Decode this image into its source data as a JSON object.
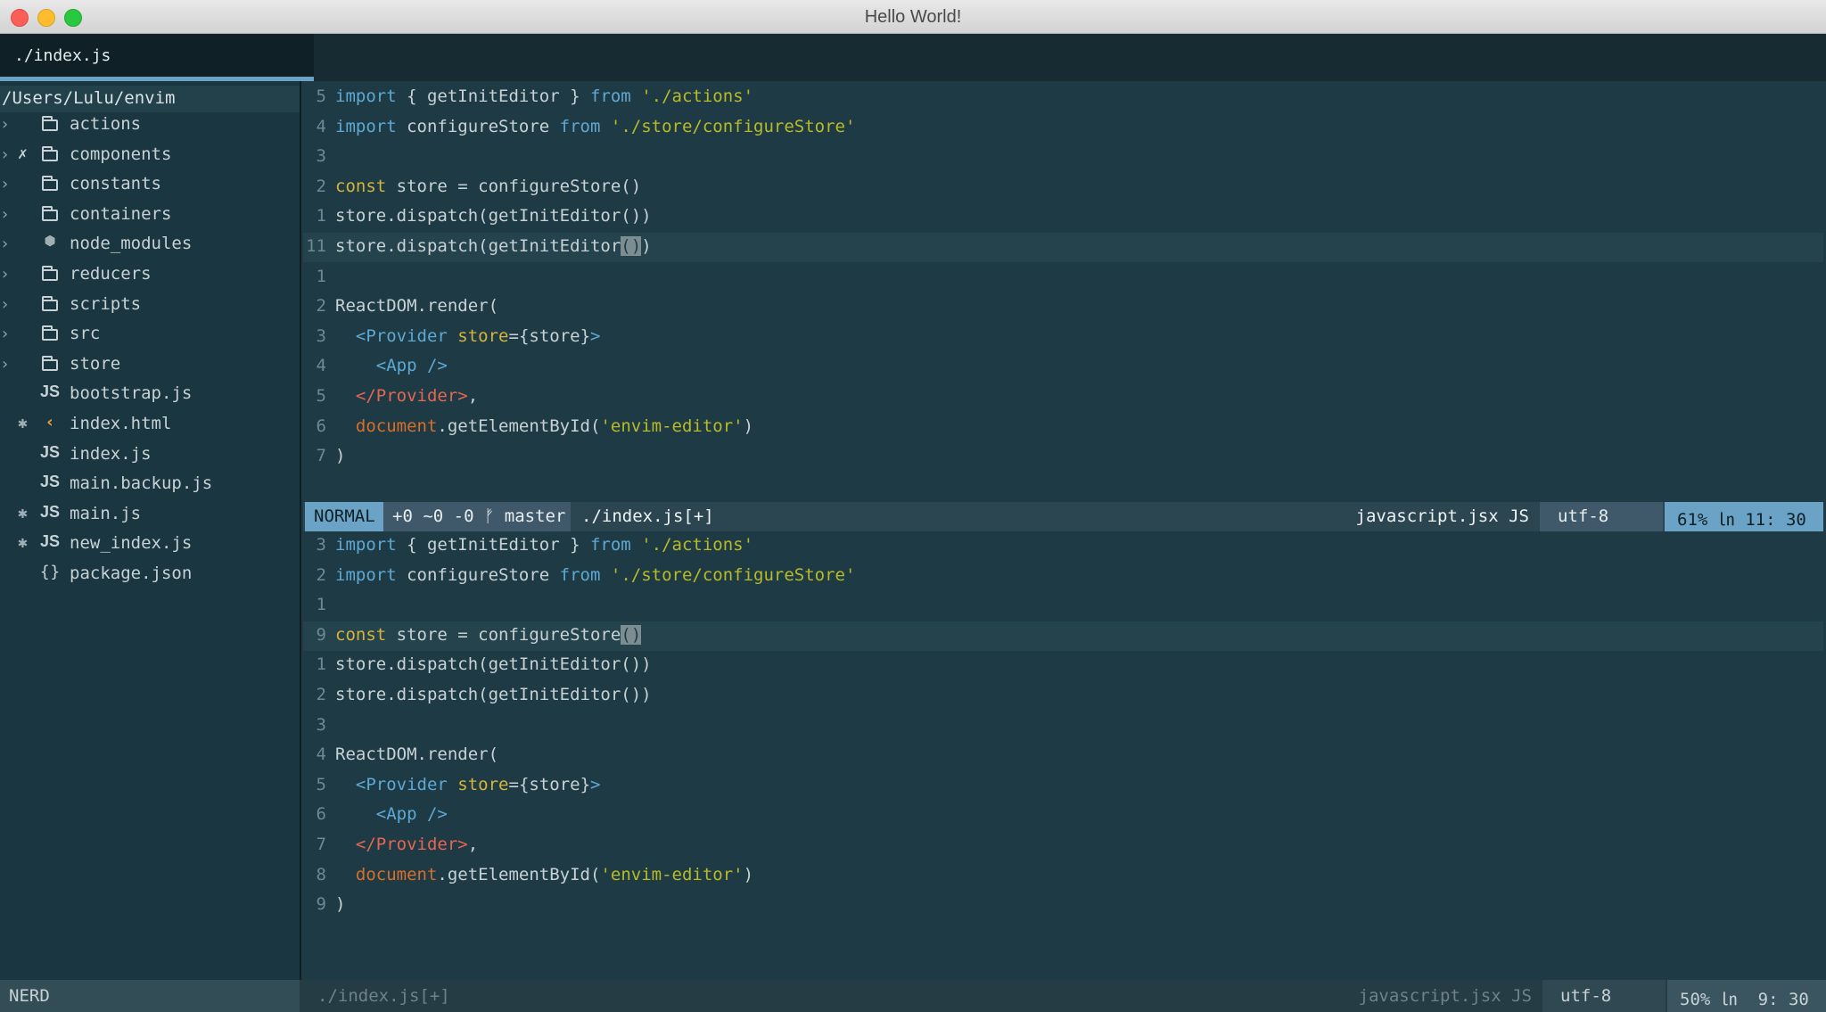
{
  "window": {
    "title": "Hello World!"
  },
  "tabline": {
    "active_tab": "./index.js"
  },
  "sidebar": {
    "root": "/Users/Lulu/envim",
    "items": [
      {
        "arrow": "›",
        "git": "",
        "icon": "folder-icon",
        "name": "actions"
      },
      {
        "arrow": "›",
        "git": "✗",
        "icon": "folder-icon",
        "name": "components"
      },
      {
        "arrow": "›",
        "git": "",
        "icon": "folder-icon",
        "name": "constants"
      },
      {
        "arrow": "›",
        "git": "",
        "icon": "folder-icon",
        "name": "containers"
      },
      {
        "arrow": "›",
        "git": "",
        "icon": "npm-icon",
        "name": "node_modules"
      },
      {
        "arrow": "›",
        "git": "",
        "icon": "folder-icon",
        "name": "reducers"
      },
      {
        "arrow": "›",
        "git": "",
        "icon": "folder-icon",
        "name": "scripts"
      },
      {
        "arrow": "›",
        "git": "",
        "icon": "folder-icon",
        "name": "src"
      },
      {
        "arrow": "›",
        "git": "",
        "icon": "folder-icon",
        "name": "store"
      },
      {
        "arrow": "",
        "git": "",
        "icon": "js-icon",
        "name": "bootstrap.js"
      },
      {
        "arrow": "",
        "git": "✱",
        "icon": "html-icon",
        "name": "index.html"
      },
      {
        "arrow": "",
        "git": "",
        "icon": "js-icon",
        "name": "index.js"
      },
      {
        "arrow": "",
        "git": "",
        "icon": "js-icon",
        "name": "main.backup.js"
      },
      {
        "arrow": "",
        "git": "✱",
        "icon": "js-icon",
        "name": "main.js"
      },
      {
        "arrow": "",
        "git": "✱",
        "icon": "js-icon",
        "name": "new_index.js"
      },
      {
        "arrow": "",
        "git": "",
        "icon": "json-icon",
        "name": "package.json"
      }
    ]
  },
  "top_pane": {
    "lines": [
      {
        "n": "5",
        "tokens": [
          [
            "kw",
            "import"
          ],
          [
            "",
            "{ getInitEditor } "
          ],
          [
            "kw",
            "from"
          ],
          [
            "",
            " "
          ],
          [
            "str",
            "'./actions'"
          ]
        ]
      },
      {
        "n": "4",
        "tokens": [
          [
            "kw",
            "import"
          ],
          [
            "",
            " configureStore "
          ],
          [
            "kw",
            "from"
          ],
          [
            "",
            " "
          ],
          [
            "str",
            "'./store/configureStore'"
          ]
        ]
      },
      {
        "n": "3",
        "tokens": []
      },
      {
        "n": "2",
        "tokens": [
          [
            "cst",
            "const"
          ],
          [
            "",
            " store = configureStore()"
          ]
        ]
      },
      {
        "n": "1",
        "tokens": [
          [
            "",
            "store.dispatch(getInitEditor())"
          ]
        ]
      },
      {
        "n": "11",
        "cursorline": true,
        "tokens": [
          [
            "",
            "store.dispatch(getInitEditor"
          ],
          [
            "cur",
            "()"
          ],
          [
            "",
            ")"
          ]
        ]
      },
      {
        "n": "1",
        "tokens": []
      },
      {
        "n": "2",
        "tokens": [
          [
            "",
            "ReactDOM.render("
          ]
        ]
      },
      {
        "n": "3",
        "tokens": [
          [
            "",
            "  "
          ],
          [
            "tag",
            "<Provider"
          ],
          [
            "",
            " "
          ],
          [
            "attr",
            "store"
          ],
          [
            "",
            "={store}"
          ],
          [
            "tag",
            ">"
          ]
        ]
      },
      {
        "n": "4",
        "tokens": [
          [
            "",
            "    "
          ],
          [
            "tag",
            "<App />"
          ]
        ]
      },
      {
        "n": "5",
        "tokens": [
          [
            "",
            "  "
          ],
          [
            "ctag",
            "</Provider>"
          ],
          [
            "",
            ","
          ]
        ]
      },
      {
        "n": "6",
        "tokens": [
          [
            "",
            "  "
          ],
          [
            "doc",
            "document"
          ],
          [
            "",
            ".getElementById("
          ],
          [
            "str",
            "'envim-editor'"
          ],
          [
            "",
            ")"
          ]
        ]
      },
      {
        "n": "7",
        "tokens": [
          [
            "",
            ")"
          ]
        ]
      }
    ]
  },
  "statusline": {
    "mode": "NORMAL",
    "git": "+0 ~0 -0 ᚠ master",
    "file": "./index.js[+]",
    "filetype": "javascript.jsx JS",
    "encoding": "utf-8 ",
    "position": "61% ㏑ 11: 30"
  },
  "bottom_pane": {
    "lines": [
      {
        "n": "3",
        "tokens": [
          [
            "kw",
            "import"
          ],
          [
            "",
            "{ getInitEditor } "
          ],
          [
            "kw",
            "from"
          ],
          [
            "",
            " "
          ],
          [
            "str",
            "'./actions'"
          ]
        ]
      },
      {
        "n": "2",
        "tokens": [
          [
            "kw",
            "import"
          ],
          [
            "",
            " configureStore "
          ],
          [
            "kw",
            "from"
          ],
          [
            "",
            " "
          ],
          [
            "str",
            "'./store/configureStore'"
          ]
        ]
      },
      {
        "n": "1",
        "tokens": []
      },
      {
        "n": "9",
        "cursorline": true,
        "tokens": [
          [
            "cst",
            "const"
          ],
          [
            "",
            " store = configureStore"
          ],
          [
            "cur",
            "()"
          ]
        ]
      },
      {
        "n": "1",
        "tokens": [
          [
            "",
            "store.dispatch(getInitEditor())"
          ]
        ]
      },
      {
        "n": "2",
        "tokens": [
          [
            "",
            "store.dispatch(getInitEditor())"
          ]
        ]
      },
      {
        "n": "3",
        "tokens": []
      },
      {
        "n": "4",
        "tokens": [
          [
            "",
            "ReactDOM.render("
          ]
        ]
      },
      {
        "n": "5",
        "tokens": [
          [
            "",
            "  "
          ],
          [
            "tag",
            "<Provider"
          ],
          [
            "",
            " "
          ],
          [
            "attr",
            "store"
          ],
          [
            "",
            "={store}"
          ],
          [
            "tag",
            ">"
          ]
        ]
      },
      {
        "n": "6",
        "tokens": [
          [
            "",
            "    "
          ],
          [
            "tag",
            "<App />"
          ]
        ]
      },
      {
        "n": "7",
        "tokens": [
          [
            "",
            "  "
          ],
          [
            "ctag",
            "</Provider>"
          ],
          [
            "",
            ","
          ]
        ]
      },
      {
        "n": "8",
        "tokens": [
          [
            "",
            "  "
          ],
          [
            "doc",
            "document"
          ],
          [
            "",
            ".getElementById("
          ],
          [
            "str",
            "'envim-editor'"
          ],
          [
            "",
            ")"
          ]
        ]
      },
      {
        "n": "9",
        "tokens": [
          [
            "",
            ")"
          ]
        ]
      }
    ]
  },
  "bottombar": {
    "nerd": "NERD",
    "file": "./index.js[+]",
    "filetype": "javascript.jsx JS",
    "encoding": "utf-8 ",
    "position": "50% ㏑  9: 30"
  },
  "colors": {
    "background": "#1e3b45",
    "accent": "#6aa3c6",
    "keyword": "#5fa8d3",
    "string": "#b8bb26",
    "const": "#d6b43c"
  }
}
